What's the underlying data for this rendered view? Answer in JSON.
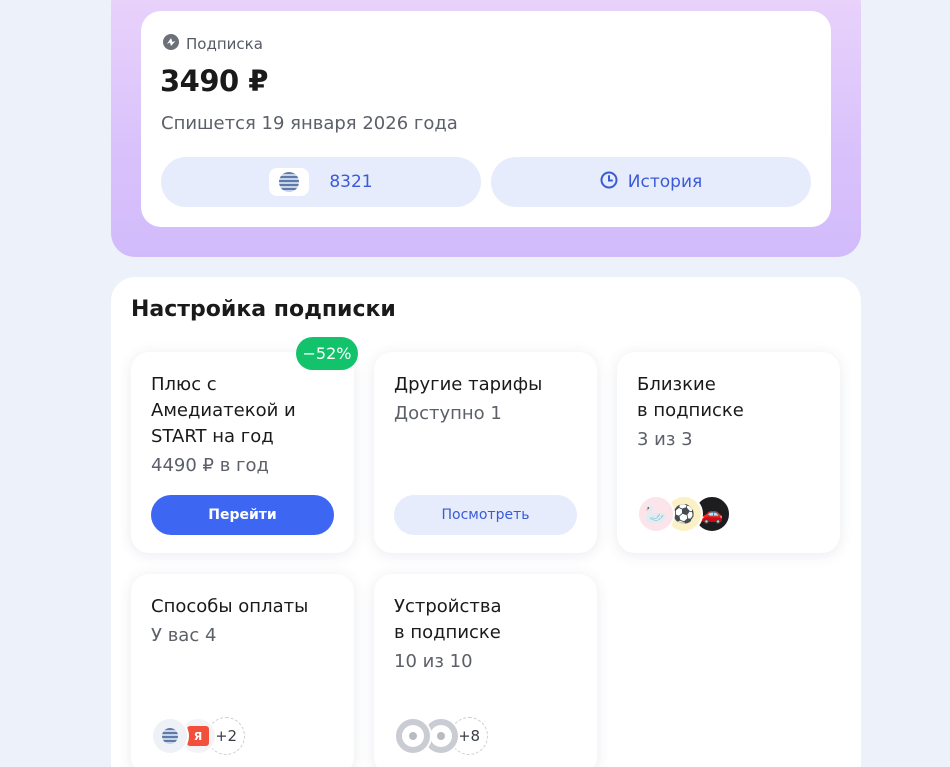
{
  "subscription": {
    "label": "Подписка",
    "price": "3490 ₽",
    "charge_text": "Спишется 19 января 2026 года",
    "card_number": "8321",
    "history_label": "История"
  },
  "settings": {
    "title": "Настройка подписки",
    "tiles": {
      "offer": {
        "badge": "−52%",
        "title": "Плюс с\nАмедиатекой и\nSTART на год",
        "subtitle": "4490 ₽ в год",
        "button": "Перейти"
      },
      "tariffs": {
        "title": "Другие тарифы",
        "subtitle": "Доступно 1",
        "button": "Посмотреть"
      },
      "family": {
        "title": "Близкие\nв подписке",
        "subtitle": "3 из 3",
        "avatars": [
          "🦢",
          "⚽",
          "🚗"
        ]
      },
      "payments": {
        "title": "Способы оплаты",
        "subtitle": "У вас 4",
        "ya_label": "Я",
        "more": "+2"
      },
      "devices": {
        "title": "Устройства\nв подписке",
        "subtitle": "10 из 10",
        "more": "+8"
      }
    }
  },
  "colors": {
    "accent": "#3d67f3",
    "badge_green": "#12c36b",
    "hero_gradient_top": "#ead4fb",
    "hero_gradient_bottom": "#d2bbfb",
    "page_bg": "#edf1f9"
  }
}
